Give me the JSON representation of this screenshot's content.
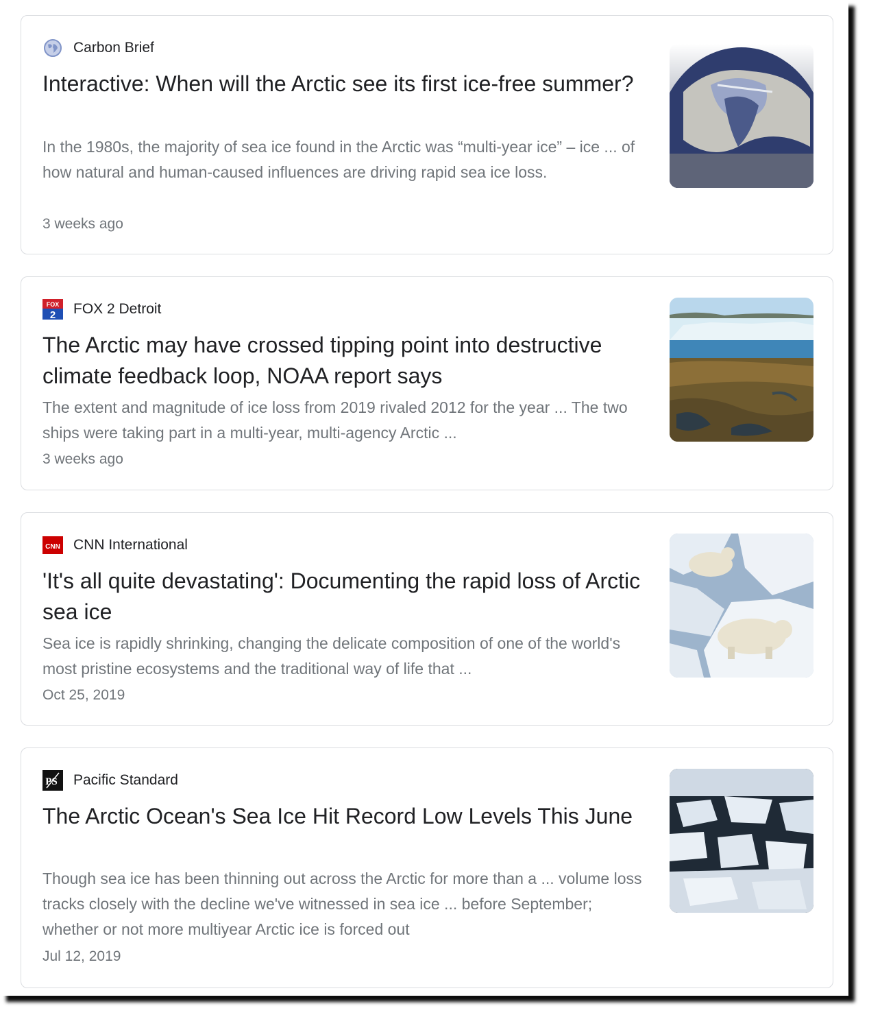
{
  "results": [
    {
      "source": "Carbon Brief",
      "source_icon": "globe-icon",
      "title": "Interactive: When will the Arctic see its first ice-free summer?",
      "snippet": "In the 1980s, the majority of sea ice found in the Arctic was “multi-year ice” – ice ... of how natural and human-caused influences are driving rapid sea ice loss.",
      "time": "3 weeks ago"
    },
    {
      "source": "FOX 2 Detroit",
      "source_icon": "fox2-logo",
      "logo_text_top": "FOX",
      "logo_text_bottom": "2",
      "title": "The Arctic may have crossed tipping point into destructive climate feedback loop, NOAA report says",
      "snippet": "The extent and magnitude of ice loss from 2019 rivaled 2012 for the year ... The two ships were taking part in a multi-year, multi-agency Arctic ...",
      "time": "3 weeks ago"
    },
    {
      "source": "CNN International",
      "source_icon": "cnn-logo",
      "logo_text": "CNN",
      "title": "'It's all quite devastating': Documenting the rapid loss of Arctic sea ice",
      "snippet": "Sea ice is rapidly shrinking, changing the delicate composition of one of the world's most pristine ecosystems and the traditional way of life that ...",
      "time": "Oct 25, 2019"
    },
    {
      "source": "Pacific Standard",
      "source_icon": "pacific-standard-logo",
      "logo_text": "PS",
      "title": "The Arctic Ocean's Sea Ice Hit Record Low Levels This June",
      "snippet": "Though sea ice has been thinning out across the Arctic for more than a ... volume loss tracks closely with the decline we've witnessed in sea ice ... before September; whether or not more multiyear Arctic ice is forced out",
      "time": "Jul 12, 2019"
    }
  ],
  "colors": {
    "title": "#202124",
    "snippet": "#70757a",
    "border": "#dadce0",
    "fox_red": "#d0202a",
    "fox_blue": "#1f4fb4",
    "cnn_red": "#cc0000"
  }
}
